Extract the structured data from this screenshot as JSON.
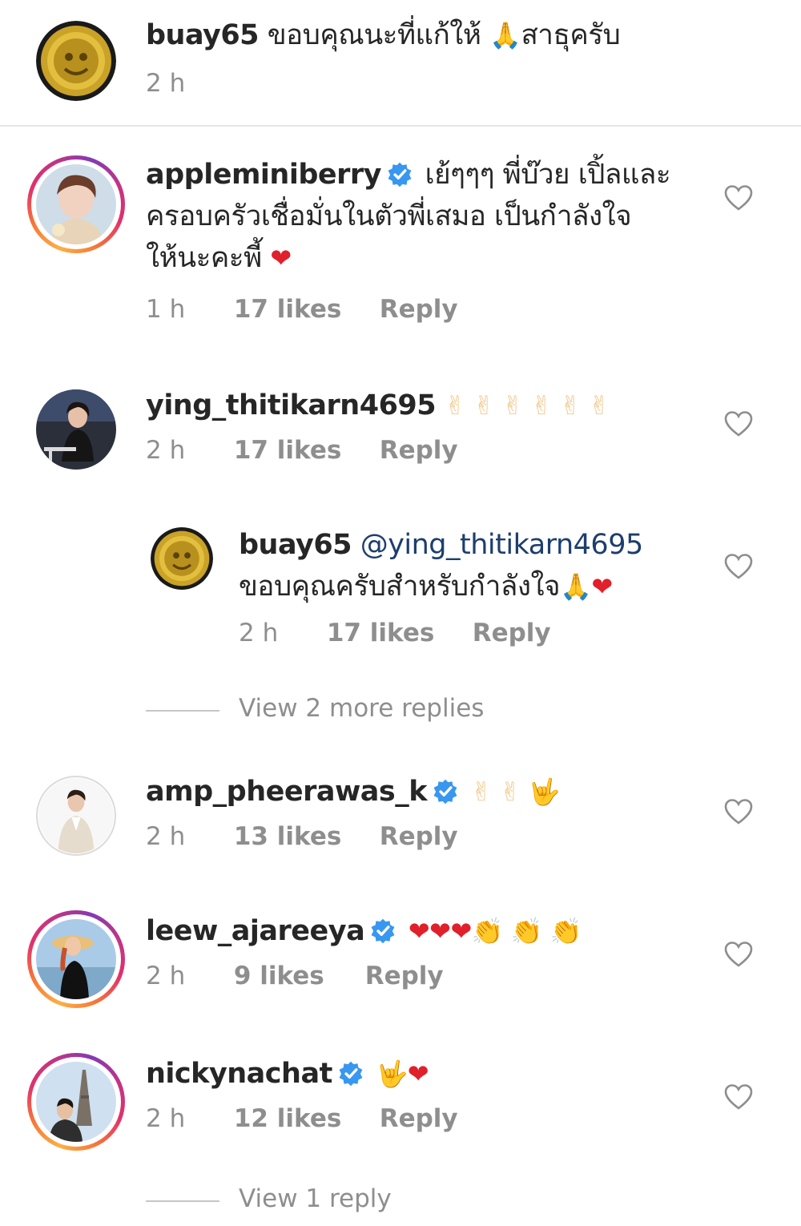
{
  "caption": {
    "username": "buay65",
    "text": "ขอบคุณนะที่แก้ให้",
    "emoji": "🙏",
    "text_after": "สาธุครับ",
    "time": "2 h"
  },
  "comments": [
    {
      "username": "appleminiberry",
      "verified": true,
      "text_line1": "เย้ๆๆๆ พี่บ๊วย เปิ้ลและ",
      "text_line2": "ครอบครัวเชื่อมั่นในตัวพี่เสมอ เป็นกำลังใจ",
      "text_line3": "ให้นะคะพี้",
      "emoji": "❤",
      "time": "1 h",
      "likes": "17 likes",
      "reply_label": "Reply"
    },
    {
      "username": "ying_thitikarn4695",
      "verified": false,
      "emoji": "✌ ✌ ✌ ✌ ✌ ✌",
      "time": "2 h",
      "likes": "17 likes",
      "reply_label": "Reply"
    },
    {
      "username": "buay65",
      "mention": "@ying_thitikarn4695",
      "text": "ขอบคุณครับสำหรับกำลังใจ",
      "emoji_pray": "🙏",
      "emoji_heart": "❤",
      "time": "2 h",
      "likes": "17 likes",
      "reply_label": "Reply"
    },
    {
      "username": "amp_pheerawas_k",
      "verified": true,
      "emoji": "✌ ✌ 🤟",
      "time": "2 h",
      "likes": "13 likes",
      "reply_label": "Reply"
    },
    {
      "username": "leew_ajareeya",
      "verified": true,
      "emoji_hearts": "❤❤❤",
      "emoji_clap": "👏 👏 👏",
      "time": "2 h",
      "likes": "9 likes",
      "reply_label": "Reply"
    },
    {
      "username": "nickynachat",
      "verified": true,
      "emoji_hand": "🤟",
      "emoji_heart": "❤",
      "time": "2 h",
      "likes": "12 likes",
      "reply_label": "Reply"
    }
  ],
  "view_more_replies": "View 2 more replies",
  "view_one_reply": "View 1 reply",
  "colors": {
    "username": "#262626",
    "meta": "#8e8e8e",
    "mention": "#1d3e6e",
    "verified": "#3897f0",
    "heart": "#e0202a",
    "divider": "#e6e6e6"
  },
  "icons": [
    "verified-badge-icon",
    "heart-outline-icon"
  ]
}
